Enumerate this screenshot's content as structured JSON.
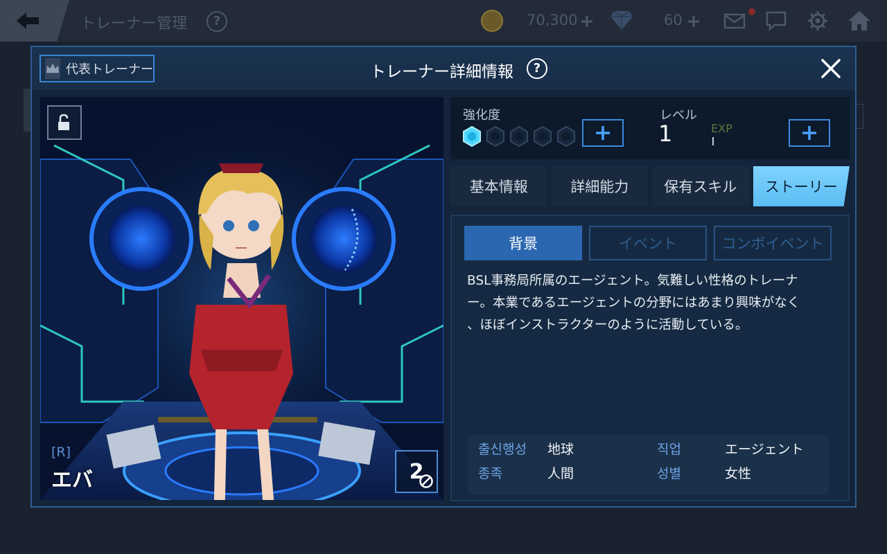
{
  "topbar": {
    "title": "トレーナー管理",
    "help": "?",
    "coins": "70,300",
    "gems": "60",
    "plus": "+"
  },
  "modal": {
    "title": "トレーナー詳細情報",
    "help": "?",
    "representative_label": "代表トレーナー"
  },
  "character": {
    "rarity": "[R]",
    "name": "エバ",
    "badge_count": "2"
  },
  "stats": {
    "enhance_label": "強化度",
    "enhance_level": 1,
    "enhance_max": 5,
    "level_label": "レベル",
    "level_value": "1",
    "exp_label": "EXP",
    "exp_progress": 0.0,
    "plus": "+"
  },
  "tabs": [
    {
      "label": "基本情報",
      "active": false
    },
    {
      "label": "詳細能力",
      "active": false
    },
    {
      "label": "保有スキル",
      "active": false
    },
    {
      "label": "ストーリー",
      "active": true
    }
  ],
  "story": {
    "subtabs": [
      {
        "label": "背景",
        "active": true
      },
      {
        "label": "イベント",
        "active": false
      },
      {
        "label": "コンボイベント",
        "active": false
      }
    ],
    "lines": [
      "BSL事務局所属のエージェント。気難しい性格のトレーナ",
      "ー。本業であるエージェントの分野にはあまり興味がなく",
      "、ほぼインストラクターのように活動している。"
    ],
    "profile": {
      "origin_label": "출신행성",
      "origin_value": "地球",
      "job_label": "직업",
      "job_value": "エージェント",
      "race_label": "종족",
      "race_value": "人間",
      "gender_label": "성별",
      "gender_value": "女性"
    }
  },
  "colors": {
    "accent": "#3d8ae0",
    "active_tab": "#6ccaf9",
    "enhance_gem": "#4fd8ff"
  }
}
